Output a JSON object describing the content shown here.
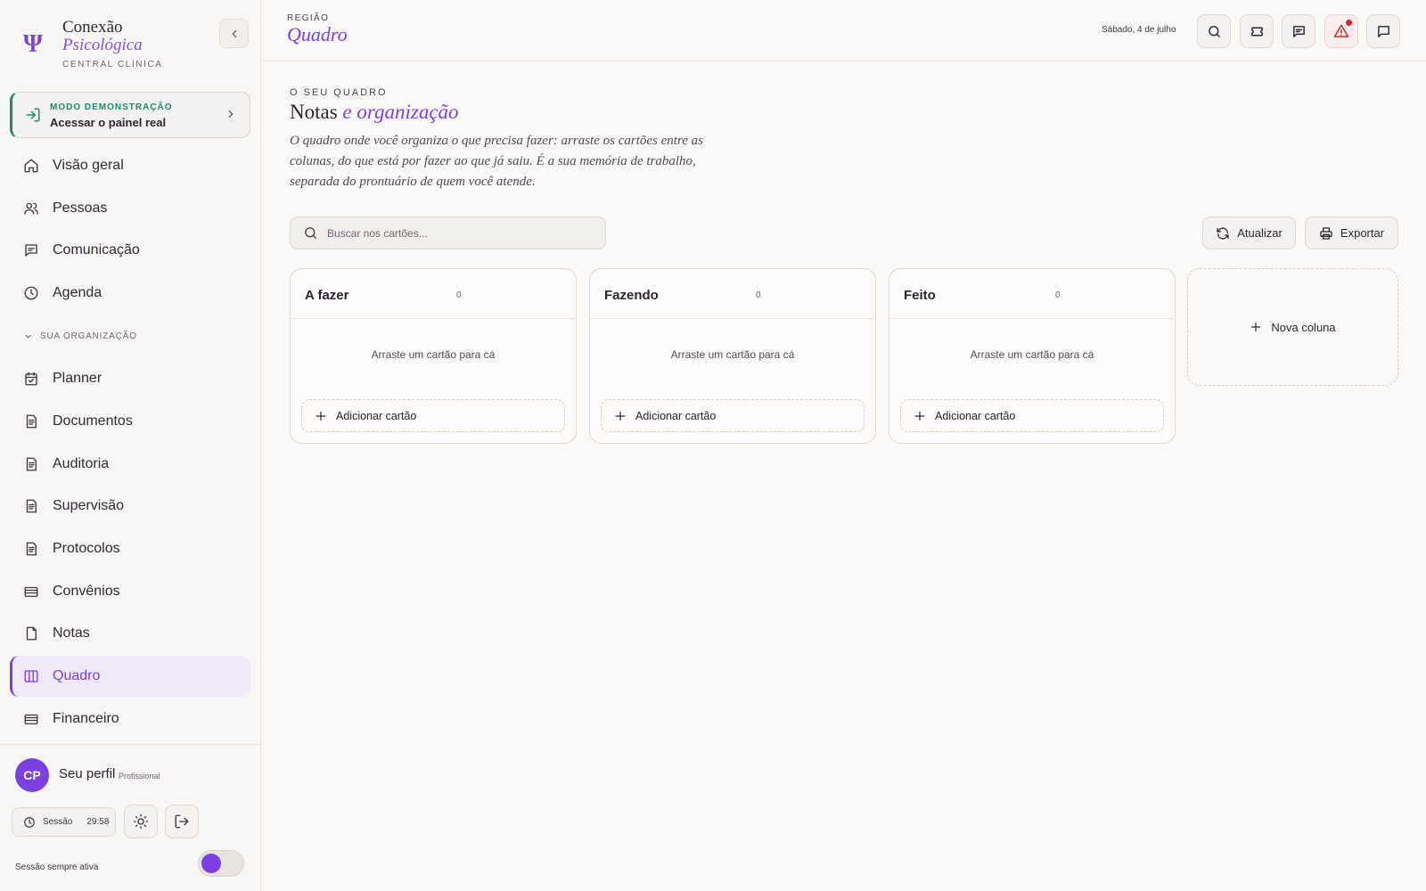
{
  "brand": {
    "line1": "Conexão",
    "line2": "Psicológica",
    "sub": "CENTRAL CLÍNICA"
  },
  "demo": {
    "kicker": "MODO DEMONSTRAÇÃO",
    "title": "Acessar o painel real"
  },
  "nav": {
    "items": [
      {
        "label": "Visão geral",
        "icon": "home-icon"
      },
      {
        "label": "Pessoas",
        "icon": "users-icon"
      },
      {
        "label": "Comunicação",
        "icon": "message-icon"
      },
      {
        "label": "Agenda",
        "icon": "clock-icon"
      }
    ],
    "section_label": "SUA ORGANIZAÇÃO",
    "org_items": [
      {
        "label": "Planner",
        "icon": "calendar-check-icon"
      },
      {
        "label": "Documentos",
        "icon": "document-icon"
      },
      {
        "label": "Auditoria",
        "icon": "document-icon"
      },
      {
        "label": "Supervisão",
        "icon": "document-icon"
      },
      {
        "label": "Protocolos",
        "icon": "document-icon"
      },
      {
        "label": "Convênios",
        "icon": "card-icon"
      },
      {
        "label": "Notas",
        "icon": "file-icon"
      },
      {
        "label": "Quadro",
        "icon": "columns-icon",
        "active": true
      },
      {
        "label": "Financeiro",
        "icon": "card-icon"
      }
    ]
  },
  "profile": {
    "initials": "CP",
    "name": "Seu perfil",
    "role": "Profissional",
    "session_label": "Sessão",
    "session_time": "29:58",
    "keep_active_label": "Sessão sempre ativa",
    "keep_active": true
  },
  "topbar": {
    "kicker": "REGIÃO",
    "title": "Quadro",
    "date": "Sábado, 4 de julho"
  },
  "page": {
    "kicker": "O SEU QUADRO",
    "title_main": "Notas",
    "title_accent": "e organização",
    "description": "O quadro onde você organiza o que precisa fazer: arraste os cartões entre as colunas, do que está por fazer ao que já saiu. É a sua memória de trabalho, separada do prontuário de quem você atende."
  },
  "search": {
    "placeholder": "Buscar nos cartões...",
    "value": ""
  },
  "actions": {
    "refresh": "Atualizar",
    "export": "Exportar"
  },
  "board": {
    "columns": [
      {
        "title": "A fazer",
        "count": "0",
        "empty": "Arraste um cartão para cá",
        "add": "Adicionar cartão"
      },
      {
        "title": "Fazendo",
        "count": "0",
        "empty": "Arraste um cartão para cá",
        "add": "Adicionar cartão"
      },
      {
        "title": "Feito",
        "count": "0",
        "empty": "Arraste um cartão para cá",
        "add": "Adicionar cartão"
      }
    ],
    "new_column": "Nova coluna"
  },
  "colors": {
    "accent": "#7b3fe4",
    "demo": "#1e8a6e",
    "alert": "#d4242a"
  }
}
